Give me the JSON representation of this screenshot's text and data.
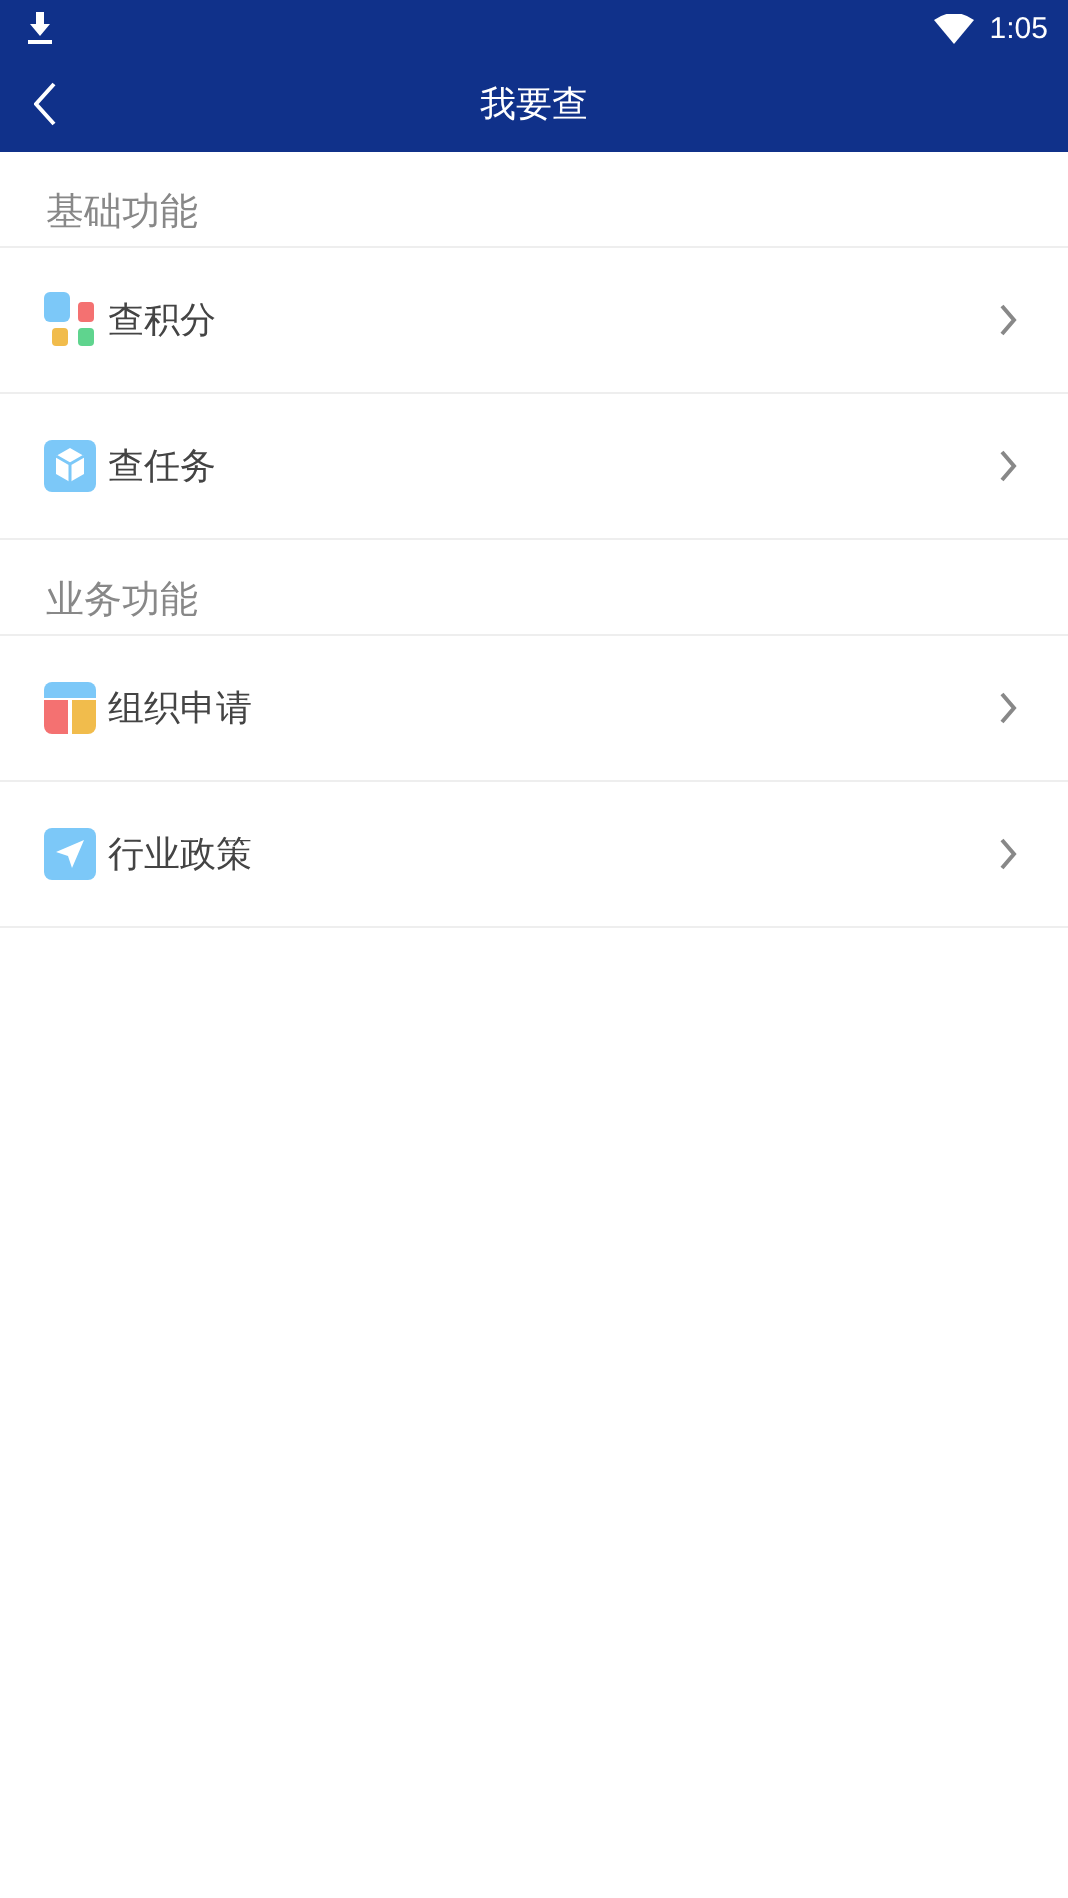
{
  "status_bar": {
    "time": "1:05"
  },
  "header": {
    "title": "我要查"
  },
  "sections": [
    {
      "title": "基础功能",
      "items": [
        {
          "label": "查积分",
          "kind": "tiles"
        },
        {
          "label": "查任务",
          "kind": "cube"
        }
      ]
    },
    {
      "title": "业务功能",
      "items": [
        {
          "label": "组织申请",
          "kind": "layout"
        },
        {
          "label": "行业政策",
          "kind": "send"
        }
      ]
    }
  ]
}
